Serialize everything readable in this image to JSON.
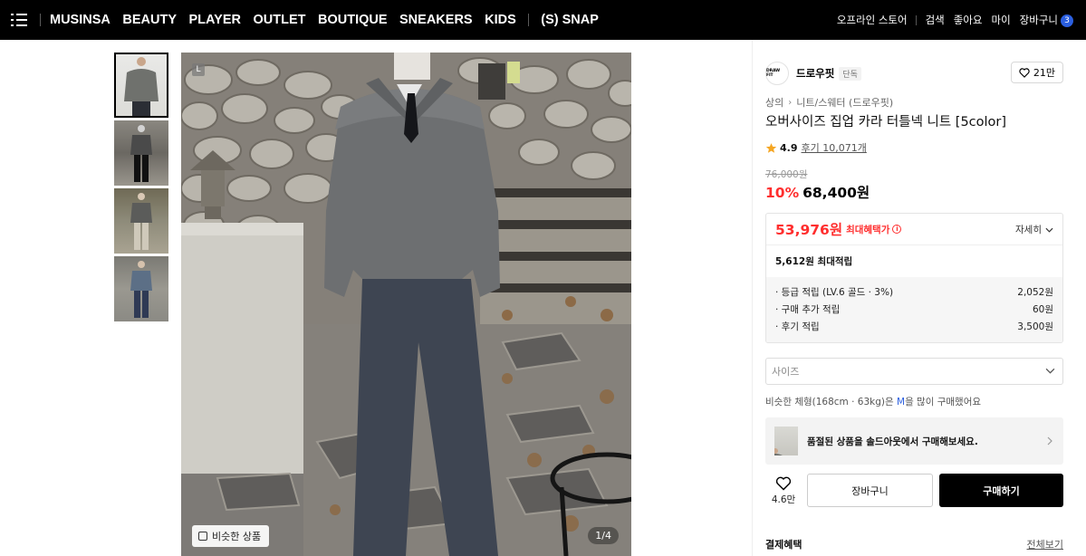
{
  "nav": {
    "items": [
      "MUSINSA",
      "BEAUTY",
      "PLAYER",
      "OUTLET",
      "BOUTIQUE",
      "SNEAKERS",
      "KIDS"
    ],
    "snap": "(S) SNAP",
    "right": [
      "오프라인 스토어",
      "검색",
      "좋아요",
      "마이"
    ],
    "cart_label": "장바구니",
    "cart_count": "3"
  },
  "gallery": {
    "badge": "L",
    "similar_label": "비슷한 상품",
    "counter": "1/4"
  },
  "brand": {
    "logo_text": "DRAW FIT",
    "name": "드로우핏",
    "tag": "단독",
    "likes": "21만"
  },
  "breadcrumb": [
    "상의",
    "니트/스웨터 (드로우핏)"
  ],
  "product": {
    "title": "오버사이즈 집업 카라 터틀넥 니트 [5color]",
    "rating": "4.9",
    "reviews": "후기 10,071개",
    "original_price": "76,000원",
    "discount": "10%",
    "price": "68,400원"
  },
  "benefit": {
    "max_price": "53,976원",
    "max_label": "최대혜택가",
    "detail_label": "자세히",
    "points_total": "5,612원 최대적립",
    "lines": [
      {
        "label": "· 등급 적립 (LV.6 골드 · 3%)",
        "value": "2,052원"
      },
      {
        "label": "· 구매 추가 적립",
        "value": "60원"
      },
      {
        "label": "· 후기 적립",
        "value": "3,500원"
      }
    ]
  },
  "size": {
    "placeholder": "사이즈"
  },
  "fit_note": {
    "before": "비슷한 체형(168cm · 63kg)은 ",
    "size": "M",
    "after": "을 많이 구매했어요"
  },
  "soldout": {
    "text": "품절된 상품을 솔드아웃에서 구매해보세요."
  },
  "actions": {
    "wish_count": "4.6만",
    "cart": "장바구니",
    "buy": "구매하기"
  },
  "payment": {
    "title": "결제혜택",
    "view_all": "전체보기"
  },
  "colors": {
    "accent_red": "#ff2e2e",
    "accent_blue": "#2b5fe0",
    "nav_bg": "#000000"
  }
}
